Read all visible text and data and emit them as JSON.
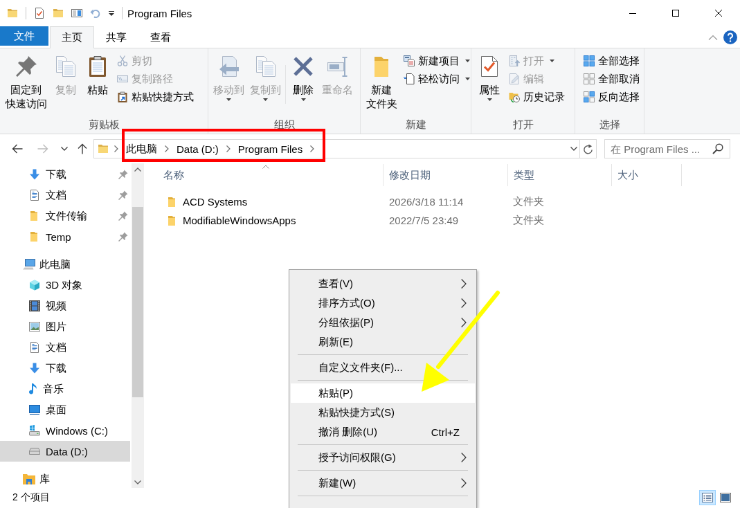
{
  "title_bar": {
    "title": "Program Files"
  },
  "ribbon": {
    "tabs": [
      {
        "label": "文件",
        "kind": "file",
        "selected": false
      },
      {
        "label": "主页",
        "kind": "tab",
        "selected": true
      },
      {
        "label": "共享",
        "kind": "tab",
        "selected": false
      },
      {
        "label": "查看",
        "kind": "tab",
        "selected": false
      }
    ],
    "groups": [
      {
        "label": "剪贴板",
        "sections": [
          {
            "kind": "large",
            "buttons": [
              {
                "label": "固定到快速访问",
                "kind": "pin",
                "disabled": false,
                "dropdown": false
              },
              {
                "label": "复制",
                "kind": "copy",
                "disabled": true,
                "dropdown": false
              },
              {
                "label": "粘贴",
                "kind": "paste",
                "disabled": false,
                "dropdown": false
              }
            ]
          },
          {
            "kind": "small",
            "buttons": [
              {
                "label": "剪切",
                "kind": "cut",
                "disabled": true,
                "dropdown": false
              },
              {
                "label": "复制路径",
                "kind": "copy-path",
                "disabled": true,
                "dropdown": false
              },
              {
                "label": "粘贴快捷方式",
                "kind": "paste-shortcut",
                "disabled": false,
                "dropdown": false
              }
            ]
          }
        ]
      },
      {
        "label": "组织",
        "sections": [
          {
            "kind": "large",
            "buttons": [
              {
                "label": "移动到",
                "kind": "move-to",
                "disabled": true,
                "dropdown": true
              },
              {
                "label": "复制到",
                "kind": "copy-to",
                "disabled": true,
                "dropdown": true
              }
            ]
          },
          {
            "kind": "large",
            "buttons": [
              {
                "label": "删除",
                "kind": "delete",
                "disabled": false,
                "dropdown": true
              },
              {
                "label": "重命名",
                "kind": "rename",
                "disabled": true,
                "dropdown": false
              }
            ]
          }
        ]
      },
      {
        "label": "新建",
        "sections": [
          {
            "kind": "large",
            "buttons": [
              {
                "label": "新建文件夹",
                "kind": "new-folder",
                "disabled": false,
                "dropdown": false
              }
            ]
          },
          {
            "kind": "small",
            "buttons": [
              {
                "label": "新建项目",
                "kind": "new-item",
                "disabled": false,
                "dropdown": true
              },
              {
                "label": "轻松访问",
                "kind": "easy-access",
                "disabled": false,
                "dropdown": true
              }
            ]
          }
        ]
      },
      {
        "label": "打开",
        "sections": [
          {
            "kind": "large",
            "buttons": [
              {
                "label": "属性",
                "kind": "properties",
                "disabled": false,
                "dropdown": true
              }
            ]
          },
          {
            "kind": "small",
            "buttons": [
              {
                "label": "打开",
                "kind": "open",
                "disabled": true,
                "dropdown": true
              },
              {
                "label": "编辑",
                "kind": "edit",
                "disabled": true,
                "dropdown": false
              },
              {
                "label": "历史记录",
                "kind": "history",
                "disabled": false,
                "dropdown": false
              }
            ]
          }
        ]
      },
      {
        "label": "选择",
        "sections": [
          {
            "kind": "small",
            "buttons": [
              {
                "label": "全部选择",
                "kind": "select-all",
                "disabled": false,
                "dropdown": false
              },
              {
                "label": "全部取消",
                "kind": "select-none",
                "disabled": false,
                "dropdown": false
              },
              {
                "label": "反向选择",
                "kind": "invert-selection",
                "disabled": false,
                "dropdown": false
              }
            ]
          }
        ]
      }
    ]
  },
  "address_bar": {
    "nav_buttons": [
      {
        "kind": "back",
        "disabled": false
      },
      {
        "kind": "forward",
        "disabled": true
      },
      {
        "kind": "recent",
        "disabled": false
      },
      {
        "kind": "up",
        "disabled": false
      }
    ],
    "breadcrumbs": [
      "此电脑",
      "Data (D:)",
      "Program Files"
    ],
    "search": {
      "placeholder": "在 Program Files ..."
    }
  },
  "navigation": {
    "quick_access": [
      {
        "label": "下载",
        "kind": "download",
        "pinned": true,
        "selected": false
      },
      {
        "label": "文档",
        "kind": "documents",
        "pinned": true,
        "selected": false
      },
      {
        "label": "文件传输",
        "kind": "folder",
        "pinned": true,
        "selected": false
      },
      {
        "label": "Temp",
        "kind": "folder",
        "pinned": true,
        "selected": false
      }
    ],
    "tree": [
      {
        "label": "此电脑",
        "kind": "pc",
        "pinned": false,
        "selected": false,
        "children": [
          {
            "label": "3D 对象",
            "kind": "objects",
            "pinned": false,
            "selected": false
          },
          {
            "label": "视频",
            "kind": "videos",
            "pinned": false,
            "selected": false
          },
          {
            "label": "图片",
            "kind": "pictures",
            "pinned": false,
            "selected": false
          },
          {
            "label": "文档",
            "kind": "documents",
            "pinned": false,
            "selected": false
          },
          {
            "label": "下载",
            "kind": "download",
            "pinned": false,
            "selected": false
          },
          {
            "label": "音乐",
            "kind": "music",
            "pinned": false,
            "selected": false
          },
          {
            "label": "桌面",
            "kind": "desktop",
            "pinned": false,
            "selected": false
          },
          {
            "label": "Windows (C:)",
            "kind": "sysdrive",
            "pinned": false,
            "selected": false
          },
          {
            "label": "Data (D:)",
            "kind": "drive",
            "pinned": false,
            "selected": true
          }
        ]
      },
      {
        "label": "库",
        "kind": "library",
        "pinned": false,
        "selected": false
      }
    ]
  },
  "file_list": {
    "columns": [
      {
        "label": "名称",
        "sorted": true
      },
      {
        "label": "修改日期",
        "sorted": false
      },
      {
        "label": "类型",
        "sorted": false
      },
      {
        "label": "大小",
        "sorted": false
      }
    ],
    "rows": [
      {
        "name": "ACD Systems",
        "modified": "2026/3/18 11:14",
        "type": "文件夹"
      },
      {
        "name": "ModifiableWindowsApps",
        "modified": "2022/7/5 23:49",
        "type": "文件夹"
      }
    ]
  },
  "context_menu": {
    "items": [
      {
        "kind": "item",
        "label": "查看(V)",
        "submenu": true,
        "selected": false
      },
      {
        "kind": "item",
        "label": "排序方式(O)",
        "submenu": true,
        "selected": false
      },
      {
        "kind": "item",
        "label": "分组依据(P)",
        "submenu": true,
        "selected": false
      },
      {
        "kind": "item",
        "label": "刷新(E)",
        "submenu": false,
        "selected": false
      },
      {
        "kind": "separator"
      },
      {
        "kind": "item",
        "label": "自定义文件夹(F)...",
        "submenu": false,
        "selected": false
      },
      {
        "kind": "separator"
      },
      {
        "kind": "item",
        "label": "粘贴(P)",
        "submenu": false,
        "selected": true
      },
      {
        "kind": "item",
        "label": "粘贴快捷方式(S)",
        "submenu": false,
        "selected": false
      },
      {
        "kind": "item",
        "label": "撤消 删除(U)",
        "shortcut": "Ctrl+Z",
        "submenu": false,
        "selected": false
      },
      {
        "kind": "separator"
      },
      {
        "kind": "item",
        "label": "授予访问权限(G)",
        "submenu": true,
        "selected": false
      },
      {
        "kind": "separator"
      },
      {
        "kind": "item",
        "label": "新建(W)",
        "submenu": true,
        "selected": false
      },
      {
        "kind": "separator"
      }
    ]
  },
  "status_bar": {
    "item_count": "2 个项目",
    "views": [
      {
        "kind": "details",
        "selected": true
      },
      {
        "kind": "large-icons",
        "selected": false
      }
    ]
  },
  "annotations": [
    {
      "kind": "frame",
      "color": "#ff0000"
    },
    {
      "kind": "arrow",
      "color": "#ffff00"
    }
  ]
}
